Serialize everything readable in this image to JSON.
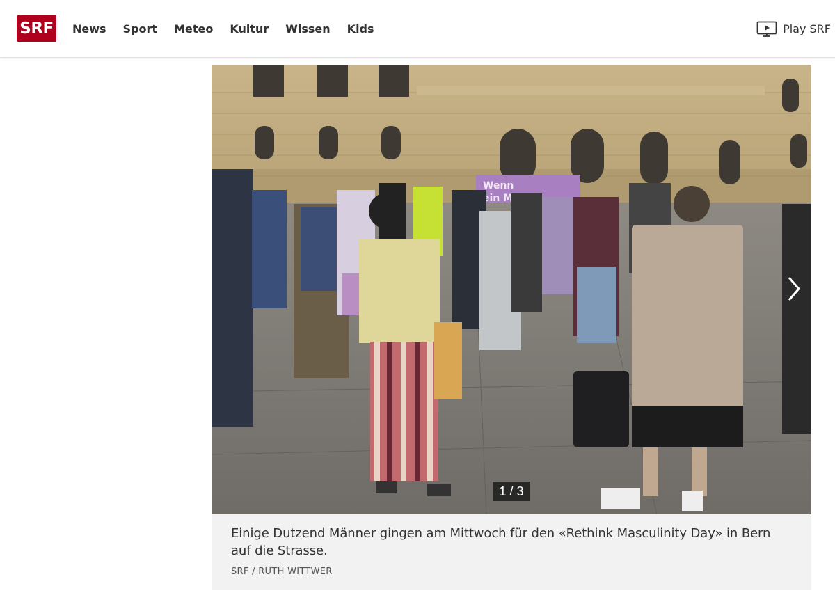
{
  "brand": {
    "logo_text": "SRF",
    "color": "#af001d"
  },
  "nav": {
    "items": [
      {
        "label": "News"
      },
      {
        "label": "Sport"
      },
      {
        "label": "Meteo"
      },
      {
        "label": "Kultur"
      },
      {
        "label": "Wissen"
      },
      {
        "label": "Kids"
      }
    ],
    "play": {
      "label": "Play SRF",
      "icon": "tv-play-icon"
    }
  },
  "gallery": {
    "counter": "1 / 3",
    "current": 1,
    "total": 3,
    "next_icon": "chevron-right-icon",
    "photo_description_icon": "protest-photo",
    "caption": "Einige Dutzend Männer gingen am Mittwoch für den «Rethink Masculinity Day» in Bern auf die Strasse.",
    "credit": "SRF / RUTH WITTWER"
  }
}
